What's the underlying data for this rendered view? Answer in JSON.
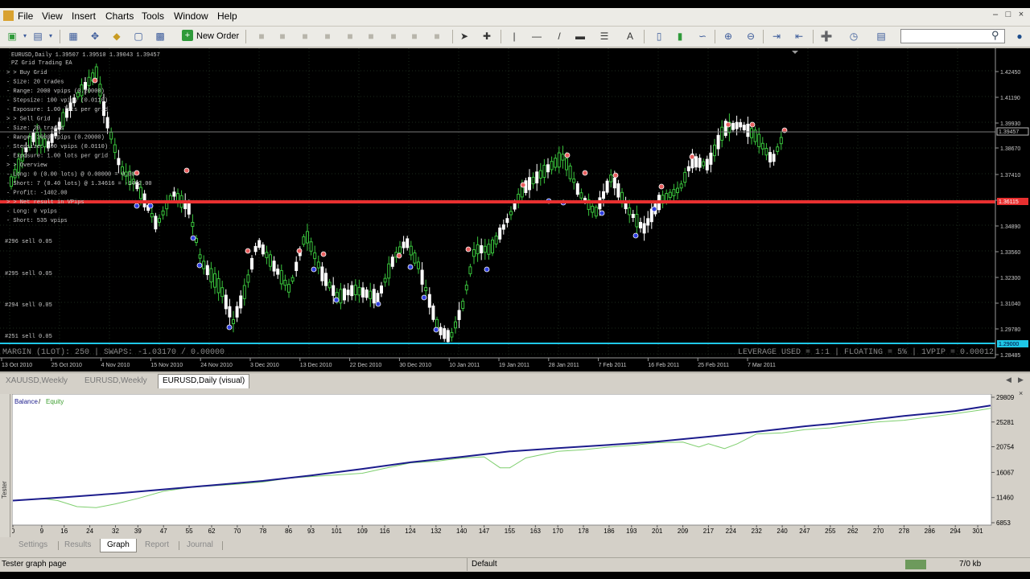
{
  "menu": [
    "File",
    "View",
    "Insert",
    "Charts",
    "Tools",
    "Window",
    "Help"
  ],
  "toolbar": {
    "new_order_label": "New Order",
    "search_placeholder": "",
    "search_icon": "search-icon"
  },
  "chart": {
    "header": "EURUSD,Daily  1.39507 1.39510 1.39043 1.39457",
    "ea_name": "PZ Grid Trading EA",
    "info_lines": [
      "> > Buy Grid",
      "- Size: 20 trades",
      "- Range: 2000 vpips (0.20000)",
      "- Stepsize: 100 vpips (0.0110)",
      "- Exposure: 1.00 lots per grid",
      "> > Sell Grid",
      "- Size: 20 trades",
      "- Range: 2000 vpips (0.20000)",
      "- Stepsize: 100 vpips (0.0110)",
      "- Exposure: 1.00 lots per grid",
      "> > Overview",
      "- Long: 0 (0.00 lots) @ 0.00000 = 0.00",
      "- Short: 7 (0.40 lots) @ 1.34616 = -1402.00",
      "- Profit: -1402.00",
      "> > Net result in VPips",
      "- Long: 0 vpips",
      "- Short: 535 vpips"
    ],
    "order_labels": [
      "#296 sell 0.05",
      "#295 sell 0.05",
      "#294 sell 0.05",
      "#251 sell 0.05"
    ],
    "price_levels": [
      "1.42450",
      "1.41190",
      "1.39930",
      "1.38670",
      "1.37410",
      "1.36150",
      "1.34890",
      "1.33560",
      "1.32300",
      "1.31040",
      "1.29780",
      "1.28485"
    ],
    "current_price": "1.39457",
    "red_line_price": "1.36115",
    "cyan_line_price": "1.29000",
    "bottom_left_text": "MARGIN (1LOT): 250 | SWAPS: -1.03170 / 0.00000",
    "bottom_right_text": "LEVERAGE USED = 1:1 | FLOATING = 5% | 1VPIP = 0.00012",
    "date_labels": [
      "13 Oct 2010",
      "25 Oct 2010",
      "4 Nov 2010",
      "15 Nov 2010",
      "24 Nov 2010",
      "3 Dec 2010",
      "13 Dec 2010",
      "22 Dec 2010",
      "30 Dec 2010",
      "10 Jan 2011",
      "19 Jan 2011",
      "28 Jan 2011",
      "7 Feb 2011",
      "16 Feb 2011",
      "25 Feb 2011",
      "7 Mar 2011"
    ],
    "colors": {
      "background": "#000000",
      "candle_up": "#ffffff",
      "candle_down": "#39c43c",
      "red_line": "#e83030",
      "cyan_line": "#1fc8e8"
    }
  },
  "chart_tabs": [
    {
      "label": "XAUUSD,Weekly",
      "active": false
    },
    {
      "label": "EURUSD,Weekly",
      "active": false
    },
    {
      "label": "EURUSD,Daily (visual)",
      "active": true
    }
  ],
  "tester": {
    "side_label": "Tester",
    "legend_balance": "Balance",
    "legend_equity": "Equity",
    "legend_sep": " / ",
    "tabs": [
      {
        "label": "Settings",
        "active": false
      },
      {
        "label": "Results",
        "active": false
      },
      {
        "label": "Graph",
        "active": true
      },
      {
        "label": "Report",
        "active": false
      },
      {
        "label": "Journal",
        "active": false
      }
    ]
  },
  "chart_data": {
    "type": "line",
    "title": "",
    "xlabel": "",
    "ylabel": "",
    "x": [
      0,
      9,
      16,
      24,
      32,
      39,
      47,
      55,
      62,
      70,
      78,
      86,
      93,
      101,
      109,
      116,
      124,
      132,
      140,
      147,
      155,
      163,
      170,
      178,
      186,
      193,
      201,
      209,
      217,
      224,
      232,
      240,
      247,
      255,
      262,
      270,
      278,
      286,
      294,
      301
    ],
    "y_ticks": [
      "29809",
      "25281",
      "20754",
      "16067",
      "11460",
      "6853"
    ],
    "ylim": [
      6853,
      29809
    ],
    "xlim": [
      0,
      305
    ],
    "series": [
      {
        "name": "Balance",
        "color": "#1c1c8c",
        "x": [
          0,
          16,
          32,
          47,
          62,
          78,
          93,
          109,
          124,
          140,
          155,
          170,
          186,
          201,
          217,
          232,
          247,
          262,
          278,
          294,
          305
        ],
        "values": [
          10900,
          11500,
          12200,
          12950,
          13700,
          14500,
          15500,
          16700,
          17900,
          18900,
          19900,
          20500,
          21100,
          21700,
          22600,
          23500,
          24500,
          25300,
          26400,
          27300,
          28300
        ]
      },
      {
        "name": "Equity",
        "color": "#7fcf6f",
        "x": [
          0,
          9,
          14,
          20,
          26,
          32,
          39,
          47,
          55,
          62,
          70,
          78,
          86,
          93,
          101,
          109,
          116,
          124,
          132,
          140,
          147,
          152,
          155,
          160,
          170,
          178,
          186,
          193,
          201,
          209,
          214,
          217,
          222,
          226,
          232,
          240,
          247,
          255,
          262,
          270,
          278,
          286,
          294,
          301,
          305
        ],
        "values": [
          10900,
          11300,
          10900,
          9800,
          9600,
          10300,
          11300,
          12600,
          13300,
          13600,
          13900,
          14300,
          15000,
          15300,
          15600,
          15900,
          16800,
          17800,
          18100,
          18700,
          18900,
          16900,
          16900,
          18700,
          19900,
          20200,
          20700,
          21000,
          21500,
          21600,
          20700,
          21300,
          20400,
          21300,
          23100,
          23300,
          23900,
          24200,
          24800,
          25300,
          25600,
          26200,
          26800,
          27400,
          27800
        ]
      }
    ]
  },
  "status": {
    "left": "Tester graph page",
    "profile": "Default",
    "traffic": "7/0 kb"
  }
}
